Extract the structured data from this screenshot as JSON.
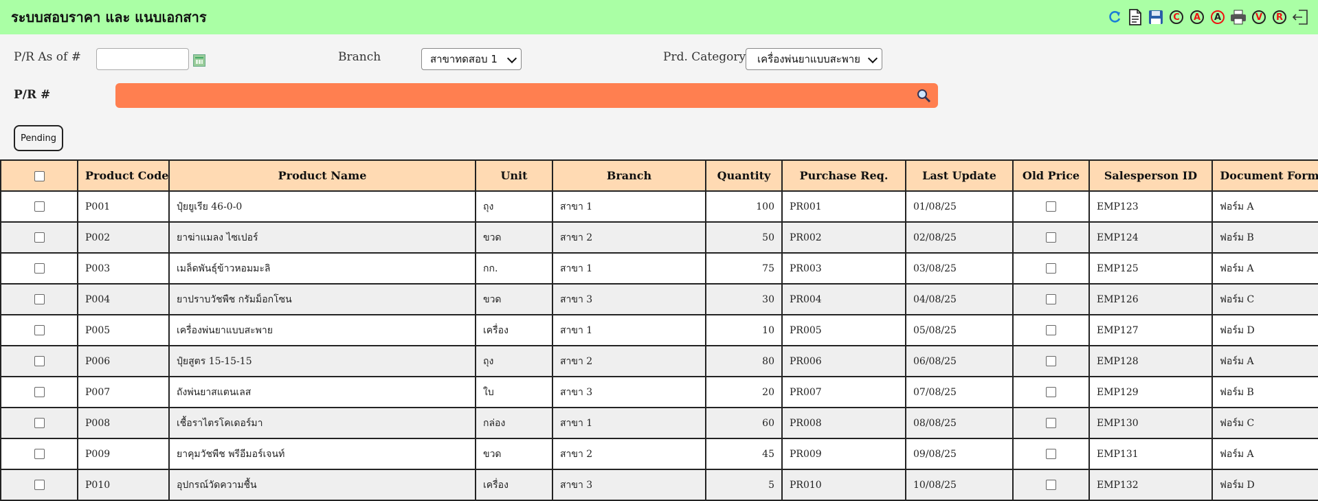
{
  "app": {
    "title": "ระบบสอบราคา และ แนบเอกสาร"
  },
  "toolbar": {
    "icons": [
      "refresh-icon",
      "document-icon",
      "save-icon",
      "c-icon",
      "a-icon",
      "a-highlight-icon",
      "print-icon",
      "v-icon",
      "r-icon",
      "exit-icon"
    ],
    "letters": {
      "c": "C",
      "a": "A",
      "a2": "A",
      "v": "V",
      "r": "R"
    }
  },
  "filters": {
    "pr_as_of_label": "P/R As of #",
    "pr_as_of_value": "",
    "branch_label": "Branch",
    "branch_selected": "สาขาทดสอบ 1",
    "category_label": "Prd. Category",
    "category_selected": "เครื่องพ่นยาแบบสะพาย",
    "pr_label": "P/R #",
    "pr_value": "",
    "pending_label": "Pending"
  },
  "colors": {
    "header_bar": "#aaffa5",
    "table_header": "#ffdab3",
    "search_bar": "#ff7f50"
  },
  "table": {
    "columns": [
      "Product Code",
      "Product Name",
      "Unit",
      "Branch",
      "Quantity",
      "Purchase Req.",
      "Last Update",
      "Old Price",
      "Salesperson ID",
      "Document Form"
    ],
    "rows": [
      {
        "code": "P001",
        "name": "ปุ๋ยยูเรีย 46-0-0",
        "unit": "ถุง",
        "branch": "สาขา 1",
        "qty": "100",
        "pr": "PR001",
        "updated": "01/08/25",
        "sales": "EMP123",
        "form": "ฟอร์ม A"
      },
      {
        "code": "P002",
        "name": "ยาฆ่าแมลง ไซเปอร์",
        "unit": "ขวด",
        "branch": "สาขา 2",
        "qty": "50",
        "pr": "PR002",
        "updated": "02/08/25",
        "sales": "EMP124",
        "form": "ฟอร์ม B"
      },
      {
        "code": "P003",
        "name": "เมล็ดพันธุ์ข้าวหอมมะลิ",
        "unit": "กก.",
        "branch": "สาขา 1",
        "qty": "75",
        "pr": "PR003",
        "updated": "03/08/25",
        "sales": "EMP125",
        "form": "ฟอร์ม A"
      },
      {
        "code": "P004",
        "name": "ยาปราบวัชพืช กรัมม็อกโซน",
        "unit": "ขวด",
        "branch": "สาขา 3",
        "qty": "30",
        "pr": "PR004",
        "updated": "04/08/25",
        "sales": "EMP126",
        "form": "ฟอร์ม C"
      },
      {
        "code": "P005",
        "name": "เครื่องพ่นยาแบบสะพาย",
        "unit": "เครื่อง",
        "branch": "สาขา 1",
        "qty": "10",
        "pr": "PR005",
        "updated": "05/08/25",
        "sales": "EMP127",
        "form": "ฟอร์ม D"
      },
      {
        "code": "P006",
        "name": "ปุ๋ยสูตร 15-15-15",
        "unit": "ถุง",
        "branch": "สาขา 2",
        "qty": "80",
        "pr": "PR006",
        "updated": "06/08/25",
        "sales": "EMP128",
        "form": "ฟอร์ม A"
      },
      {
        "code": "P007",
        "name": "ถังพ่นยาสแตนเลส",
        "unit": "ใบ",
        "branch": "สาขา 3",
        "qty": "20",
        "pr": "PR007",
        "updated": "07/08/25",
        "sales": "EMP129",
        "form": "ฟอร์ม B"
      },
      {
        "code": "P008",
        "name": "เชื้อราไตรโคเดอร์มา",
        "unit": "กล่อง",
        "branch": "สาขา 1",
        "qty": "60",
        "pr": "PR008",
        "updated": "08/08/25",
        "sales": "EMP130",
        "form": "ฟอร์ม C"
      },
      {
        "code": "P009",
        "name": "ยาคุมวัชพืช พรีอีมอร์เจนท์",
        "unit": "ขวด",
        "branch": "สาขา 2",
        "qty": "45",
        "pr": "PR009",
        "updated": "09/08/25",
        "sales": "EMP131",
        "form": "ฟอร์ม A"
      },
      {
        "code": "P010",
        "name": "อุปกรณ์วัดความชื้น",
        "unit": "เครื่อง",
        "branch": "สาขา 3",
        "qty": "5",
        "pr": "PR010",
        "updated": "10/08/25",
        "sales": "EMP132",
        "form": "ฟอร์ม D"
      }
    ]
  }
}
